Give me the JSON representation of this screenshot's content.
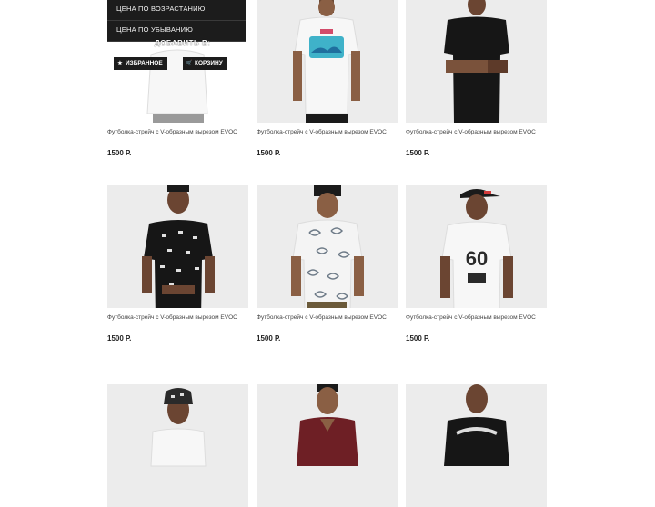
{
  "sort_menu": {
    "options": [
      "Цена по возрастанию",
      "Цена по убыванию"
    ]
  },
  "overlay": {
    "add_label": "Добавить в:",
    "favorites_label": "Избранное",
    "cart_label": "Корзину",
    "favorites_icon": "star-icon",
    "cart_icon": "cart-icon"
  },
  "products": [
    {
      "title": "Футболка-стрейч с V-образным вырезом EVOC",
      "price": "1500 Р."
    },
    {
      "title": "Футболка-стрейч с V-образным вырезом EVOC",
      "price": "1500 Р."
    },
    {
      "title": "Футболка-стрейч с V-образным вырезом EVOC",
      "price": "1500 Р."
    },
    {
      "title": "Футболка-стрейч с V-образным вырезом EVOC",
      "price": "1500 Р."
    },
    {
      "title": "Футболка-стрейч с V-образным вырезом EVOC",
      "price": "1500 Р."
    },
    {
      "title": "Футболка-стрейч с V-образным вырезом EVOC",
      "price": "1500 Р."
    },
    {
      "title": "",
      "price": ""
    },
    {
      "title": "",
      "price": ""
    },
    {
      "title": "",
      "price": ""
    }
  ],
  "print_texts": {
    "number": "60"
  },
  "colors": {
    "overlay_bg": "#1c1c1c",
    "photo_bg": "#ececec",
    "shirt_white": "#f7f7f7",
    "shirt_black": "#161616",
    "shirt_maroon": "#6e1f25"
  }
}
